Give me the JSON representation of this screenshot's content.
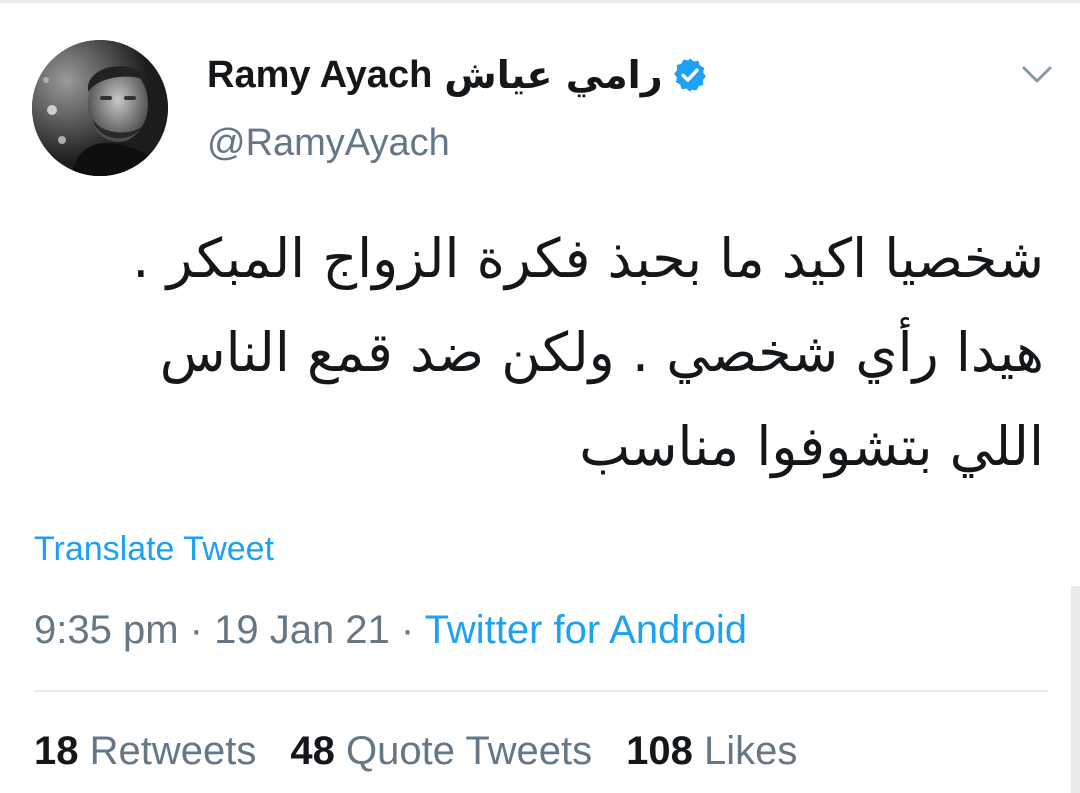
{
  "user": {
    "name_latin": "Ramy Ayach",
    "name_arabic": "رامي عياش",
    "handle": "@RamyAyach",
    "verified": true
  },
  "tweet": {
    "lines": [
      "شخصيا اكيد ما بحبذ فكرة الزواج المبكر .",
      "هيدا رأي شخصي . ولكن ضد قمع الناس",
      "اللي بتشوفوا مناسب"
    ],
    "translate_label": "Translate Tweet",
    "time": "9:35 pm",
    "date": "19 Jan 21",
    "separator": "·",
    "source": "Twitter for Android"
  },
  "stats": [
    {
      "count": "18",
      "label": "Retweets"
    },
    {
      "count": "48",
      "label": "Quote Tweets"
    },
    {
      "count": "108",
      "label": "Likes"
    }
  ],
  "colors": {
    "link": "#1da1f2",
    "secondary_text": "#657786",
    "primary_text": "#14171a",
    "divider": "#e6ecf0"
  },
  "icons": {
    "verified": "verified-badge-icon",
    "more": "chevron-down-icon"
  }
}
